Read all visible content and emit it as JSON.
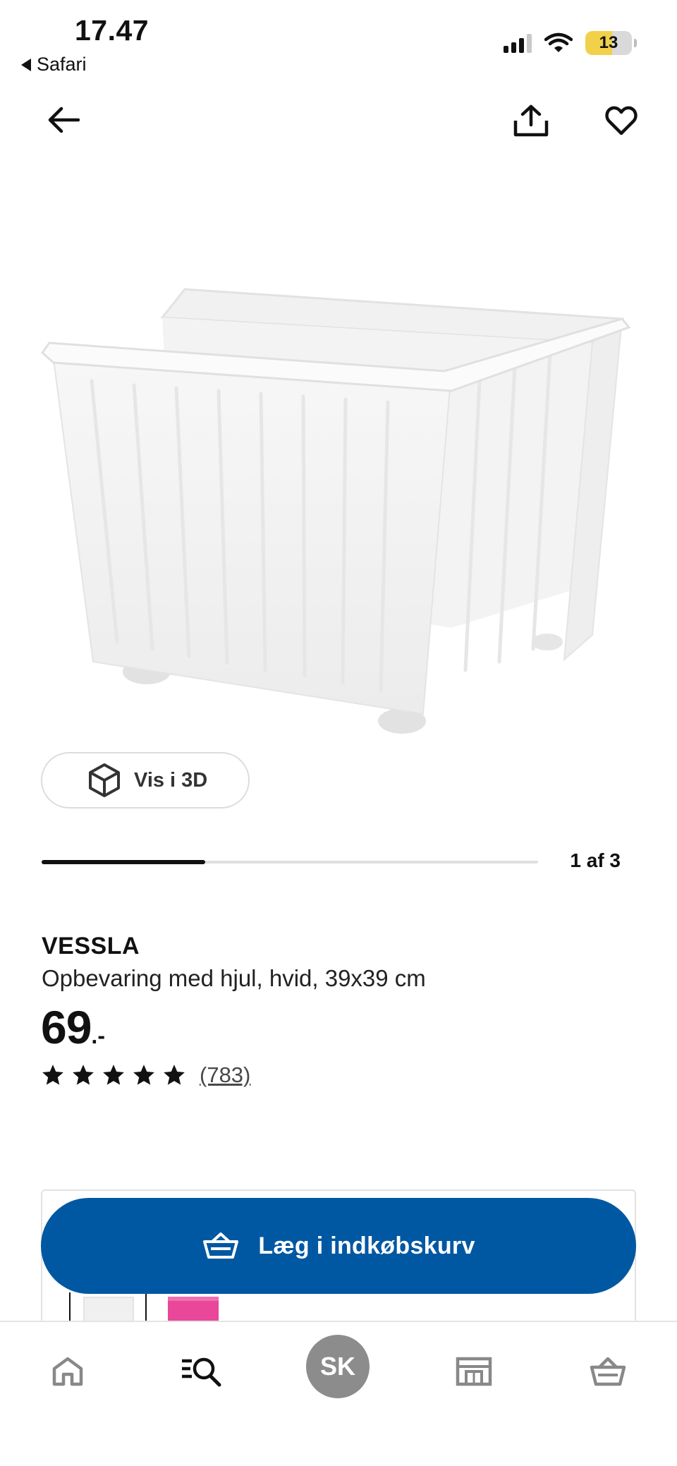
{
  "status_bar": {
    "time": "17.47",
    "back_app": "Safari",
    "battery": "13"
  },
  "icons": {
    "back": "arrow-left-icon",
    "share": "share-icon",
    "favorite": "heart-icon",
    "cube": "cube-icon",
    "basket": "basket-icon",
    "home": "home-icon",
    "search": "search-icon",
    "store": "store-icon",
    "cart": "cart-icon"
  },
  "gallery": {
    "view_3d_label": "Vis i 3D",
    "pager_text": "1 af 3",
    "progress": 0.33
  },
  "product": {
    "name": "VESSLA",
    "description": "Opbevaring med hjul, hvid, 39x39 cm",
    "price": "69",
    "price_suffix": ".-",
    "rating": 5,
    "review_count": "(783)"
  },
  "cart": {
    "add_label": "Læg i indkøbskurv",
    "accent_color": "#0058a3",
    "color_options": [
      "white",
      "pink"
    ]
  },
  "tabbar": {
    "profile_initials": "SK"
  }
}
